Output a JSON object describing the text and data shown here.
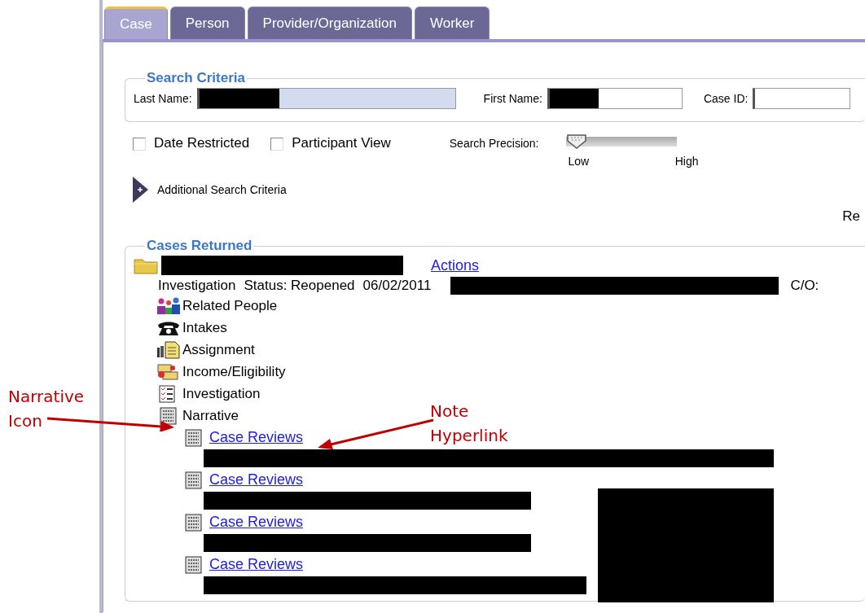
{
  "tabs": [
    {
      "label": "Case",
      "selected": true
    },
    {
      "label": "Person",
      "selected": false
    },
    {
      "label": "Provider/Organization",
      "selected": false
    },
    {
      "label": "Worker",
      "selected": false
    }
  ],
  "search_criteria": {
    "title": "Search Criteria",
    "fields": [
      {
        "label": "Last Name:"
      },
      {
        "label": "First Name:"
      },
      {
        "label": "Case ID:"
      }
    ]
  },
  "options": [
    {
      "label": "Date Restricted",
      "checked": false
    },
    {
      "label": "Participant View",
      "checked": false
    }
  ],
  "precision": {
    "label": "Search Precision:",
    "level": 0,
    "min_label": "Low",
    "max_label": "High"
  },
  "additional": "Additional Search Criteria",
  "cut_text": "Re",
  "cases": {
    "title": "Cases Returned",
    "actions": "Actions",
    "summary": [
      "Investigation",
      "Status: Reopened",
      "06/02/2011"
    ],
    "co": "C/O:",
    "items": [
      {
        "label": "Related People",
        "kind": "people"
      },
      {
        "label": "Intakes",
        "kind": "phone"
      },
      {
        "label": "Assignment",
        "kind": "assignment"
      },
      {
        "label": "Income/Eligibility",
        "kind": "income"
      },
      {
        "label": "Investigation",
        "kind": "checklist"
      },
      {
        "label": "Narrative",
        "kind": "narrative"
      }
    ],
    "notes": [
      "Case Reviews",
      "Case Reviews",
      "Case Reviews",
      "Case Reviews"
    ]
  },
  "annotations": [
    {
      "kind": "icon",
      "lines": [
        "Narrative",
        "Icon"
      ]
    },
    {
      "kind": "link",
      "lines": [
        "Note",
        "Hyperlink"
      ]
    }
  ]
}
